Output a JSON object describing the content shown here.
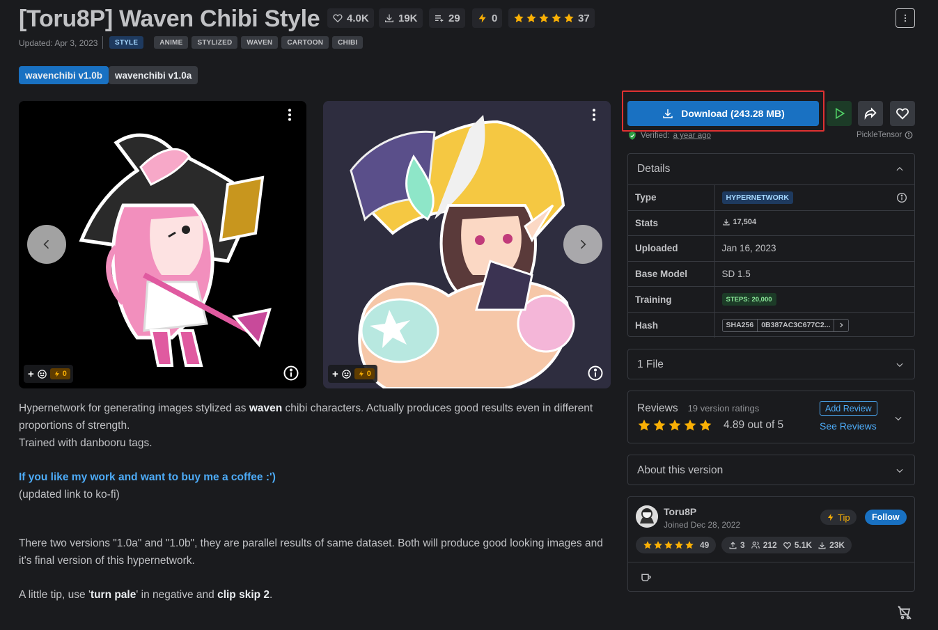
{
  "header": {
    "title": "[Toru8P] Waven Chibi Style",
    "likes": "4.0K",
    "downloads": "19K",
    "collections": "29",
    "buzz": "0",
    "rating_count": "37",
    "updated": "Updated: Apr 3, 2023",
    "tags": [
      "STYLE",
      "ANIME",
      "STYLIZED",
      "WAVEN",
      "CARTOON",
      "CHIBI"
    ]
  },
  "versions": [
    "wavenchibi v1.0b",
    "wavenchibi v1.0a"
  ],
  "gallery": {
    "image1_buzz": "0",
    "image2_buzz": "0"
  },
  "description": {
    "p1_a": "Hypernetwork for generating images stylized as ",
    "p1_bold": "waven",
    "p1_b": " chibi characters. Actually produces good results even in different proportions of strength.",
    "p2": "Trained with danbooru tags.",
    "link": "If you like my work and want to buy me a coffee :')",
    "p3": "(updated link to ko-fi)",
    "p4": "There two versions \"1.0a\" and \"1.0b\", they are parallel results of same dataset. Both will produce good looking images and it's final version of this hypernetwork.",
    "p5_a": "A little tip, use '",
    "p5_bold1": "turn pale",
    "p5_b": "' in negative and ",
    "p5_bold2": "clip skip 2",
    "p5_c": "."
  },
  "actions": {
    "download_label": "Download (243.28 MB)",
    "verified_label": "Verified:",
    "verified_time": "a year ago",
    "scanner": "PickleTensor"
  },
  "details": {
    "title": "Details",
    "rows": {
      "type_k": "Type",
      "type_v": "HYPERNETWORK",
      "stats_k": "Stats",
      "stats_v": "17,504",
      "uploaded_k": "Uploaded",
      "uploaded_v": "Jan 16, 2023",
      "base_k": "Base Model",
      "base_v": "SD 1.5",
      "training_k": "Training",
      "training_v": "STEPS: 20,000",
      "hash_k": "Hash",
      "hash_type": "SHA256",
      "hash_v": "0B387AC3C677C2..."
    }
  },
  "files": {
    "title": "1 File"
  },
  "reviews": {
    "title": "Reviews",
    "count": "19 version ratings",
    "score": "4.89 out of 5",
    "add": "Add Review",
    "see": "See Reviews"
  },
  "about": {
    "title": "About this version"
  },
  "creator": {
    "name": "Toru8P",
    "joined": "Joined Dec 28, 2022",
    "tip": "Tip",
    "follow": "Follow",
    "rating_count": "49",
    "uploads": "3",
    "followers": "212",
    "likes": "5.1K",
    "downloads": "23K"
  },
  "colors": {
    "accent": "#1971c2",
    "star": "#fab005",
    "highlight": "#e03131",
    "background": "#1a1b1e"
  }
}
